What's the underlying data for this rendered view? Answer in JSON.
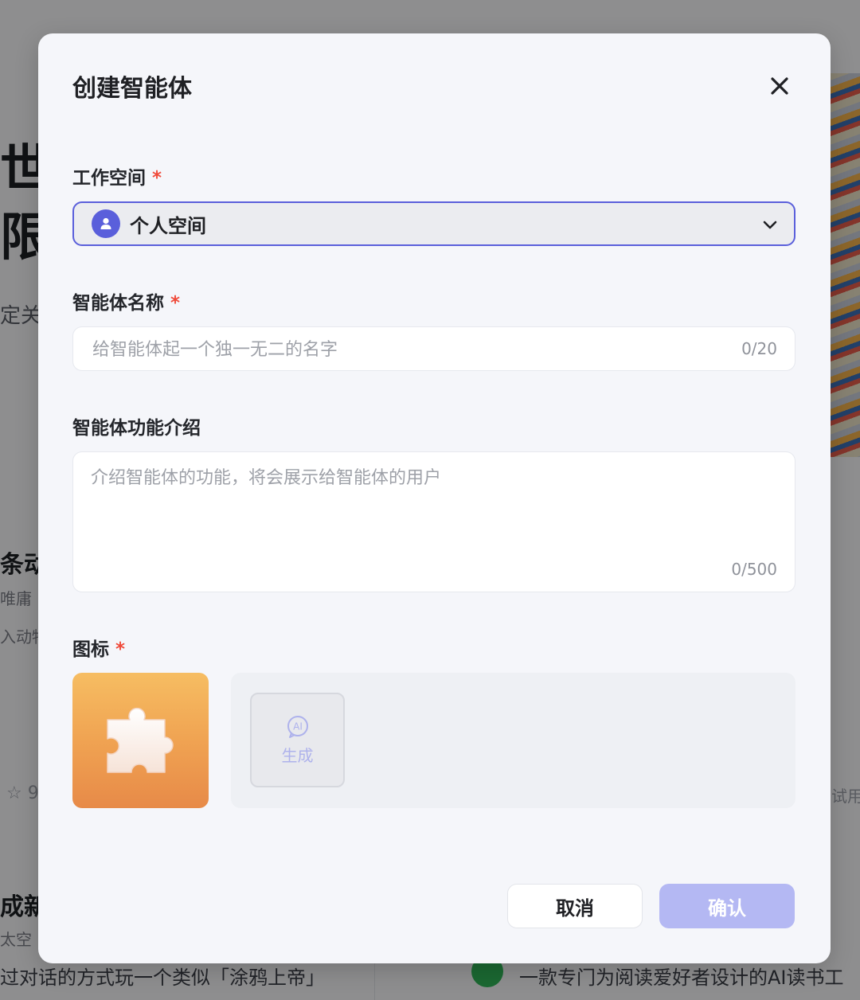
{
  "background": {
    "hero_text": "世\n限",
    "hero_sub": "定关",
    "card1_title": "条动",
    "card1_author": "唯庸",
    "card1_desc": "入动物",
    "card1_stars": "☆ 9",
    "card_try": "试用",
    "card2_title": "成新",
    "card2_author": "太空",
    "bottom_left_text": "过对话的方式玩一个类似「涂鸦上帝」",
    "bottom_right_text": "一款专门为阅读爱好者设计的AI读书工"
  },
  "modal": {
    "title": "创建智能体",
    "close_icon": "close-icon",
    "workspace": {
      "label": "工作空间",
      "required_mark": "*",
      "selected_value": "个人空间",
      "icon": "person-icon"
    },
    "name": {
      "label": "智能体名称",
      "required_mark": "*",
      "placeholder": "给智能体起一个独一无二的名字",
      "value": "",
      "counter": "0/20"
    },
    "description": {
      "label": "智能体功能介绍",
      "placeholder": "介绍智能体的功能，将会展示给智能体的用户",
      "value": "",
      "counter": "0/500"
    },
    "icon_section": {
      "label": "图标",
      "required_mark": "*",
      "selected_icon": "puzzle-piece-icon",
      "ai_badge": "AI",
      "ai_generate_label": "生成"
    },
    "buttons": {
      "cancel": "取消",
      "confirm": "确认"
    }
  },
  "colors": {
    "accent": "#5a5fdb",
    "confirm_disabled": "#b4b8f3",
    "required": "#f04a3a",
    "icon_gradient_top": "#f6bd62",
    "icon_gradient_bottom": "#e78a48"
  }
}
